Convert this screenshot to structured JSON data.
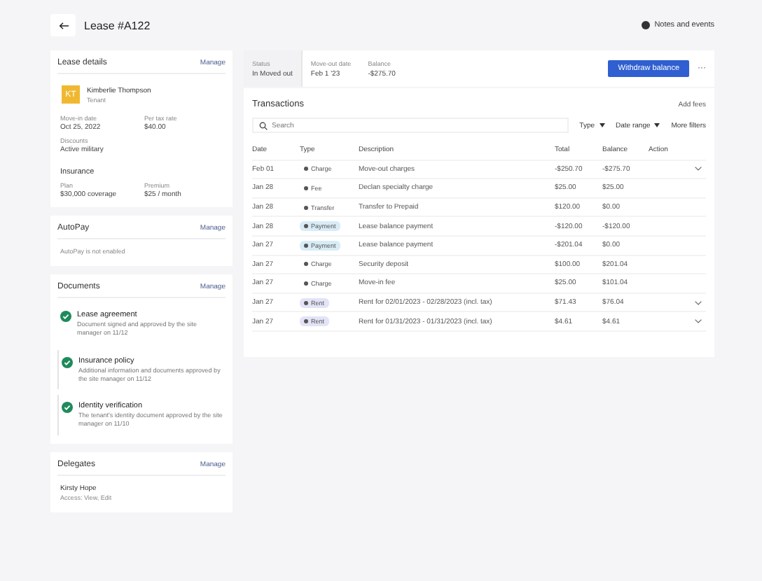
{
  "header": {
    "title": "Lease #A122",
    "notes_link": "Notes and events"
  },
  "lease_details": {
    "title": "Lease details",
    "manage": "Manage",
    "tenant": {
      "initials": "KT",
      "name": "Kimberlie Thompson",
      "role": "Tenant"
    },
    "fields": [
      {
        "label": "Move-in date",
        "value": "Oct 25, 2022"
      },
      {
        "label": "Per tax rate",
        "value": "$40.00"
      }
    ],
    "discount": {
      "label": "Discounts",
      "value": "Active military"
    },
    "insurance": {
      "title": "Insurance",
      "fields": [
        {
          "label": "Plan",
          "value": "$30,000 coverage"
        },
        {
          "label": "Premium",
          "value": "$25 / month"
        }
      ]
    }
  },
  "autopay": {
    "title": "AutoPay",
    "manage": "Manage",
    "text": "AutoPay is not enabled"
  },
  "documents": {
    "title": "Documents",
    "manage": "Manage",
    "items": [
      {
        "title": "Lease agreement",
        "text": "Document signed and approved by the site manager on 11/12",
        "checked": true
      },
      {
        "title": "Insurance policy",
        "text": "Additional information and documents approved by the site manager on 11/12",
        "checked": true
      },
      {
        "title": "Identity verification",
        "text": "The tenant's identity document approved by the site manager on 11/10",
        "checked": true
      }
    ]
  },
  "delegates": {
    "title": "Delegates",
    "manage": "Manage",
    "items": [
      {
        "name": "Kirsty Hope",
        "text": "Access: View, Edit"
      }
    ]
  },
  "summary": {
    "fields": [
      {
        "label": "Status",
        "value": "In Moved out",
        "selected": true
      },
      {
        "label": "Move-out date",
        "value": "Feb 1 '23",
        "selected": false
      },
      {
        "label": "Balance",
        "value": "-$275.70",
        "selected": false
      }
    ],
    "primary_button": "Withdraw balance",
    "more": "···"
  },
  "transactions": {
    "title": "Transactions",
    "add_link": "Add fees",
    "search": {
      "placeholder": "Search"
    },
    "filters": [
      {
        "label": "Type",
        "dropdown": true
      },
      {
        "label": "Date range",
        "dropdown": true
      },
      {
        "label": "More filters",
        "dropdown": false
      }
    ],
    "columns": [
      "Date",
      "Type",
      "Description",
      "Total",
      "Balance",
      "Action"
    ],
    "rows": [
      {
        "date": "Feb 01",
        "type": "Charge",
        "badge": false,
        "color": "#555555",
        "description": "Move-out charges",
        "total": "-$250.70",
        "balance": "-$275.70",
        "expandable": true
      },
      {
        "date": "Jan 28",
        "type": "Fee",
        "badge": false,
        "color": "#555555",
        "description": "Declan specialty charge",
        "total": "$25.00",
        "balance": "$25.00",
        "expandable": false
      },
      {
        "date": "Jan 28",
        "type": "Transfer",
        "badge": false,
        "color": "#555555",
        "description": "Transfer to Prepaid",
        "total": "$120.00",
        "balance": "$0.00",
        "expandable": false
      },
      {
        "date": "Jan 28",
        "type": "Payment",
        "badge": true,
        "color": "#d8ecf6",
        "description": "Lease balance payment",
        "total": "-$120.00",
        "balance": "-$120.00",
        "expandable": false
      },
      {
        "date": "Jan 27",
        "type": "Payment",
        "badge": true,
        "color": "#d8ecf6",
        "description": "Lease balance payment",
        "total": "-$201.04",
        "balance": "$0.00",
        "expandable": false
      },
      {
        "date": "Jan 27",
        "type": "Charge",
        "badge": false,
        "color": "#555555",
        "description": "Security deposit",
        "total": "$100.00",
        "balance": "$201.04",
        "expandable": false
      },
      {
        "date": "Jan 27",
        "type": "Charge",
        "badge": false,
        "color": "#555555",
        "description": "Move-in fee",
        "total": "$25.00",
        "balance": "$101.04",
        "expandable": false
      },
      {
        "date": "Jan 27",
        "type": "Rent",
        "badge": true,
        "color": "#e3e3f7",
        "description": "Rent for 02/01/2023 - 02/28/2023 (incl. tax)",
        "total": "$71.43",
        "balance": "$76.04",
        "expandable": true
      },
      {
        "date": "Jan 27",
        "type": "Rent",
        "badge": true,
        "color": "#e3e3f7",
        "description": "Rent for 01/31/2023 - 01/31/2023 (incl. tax)",
        "total": "$4.61",
        "balance": "$4.61",
        "expandable": true
      }
    ]
  }
}
